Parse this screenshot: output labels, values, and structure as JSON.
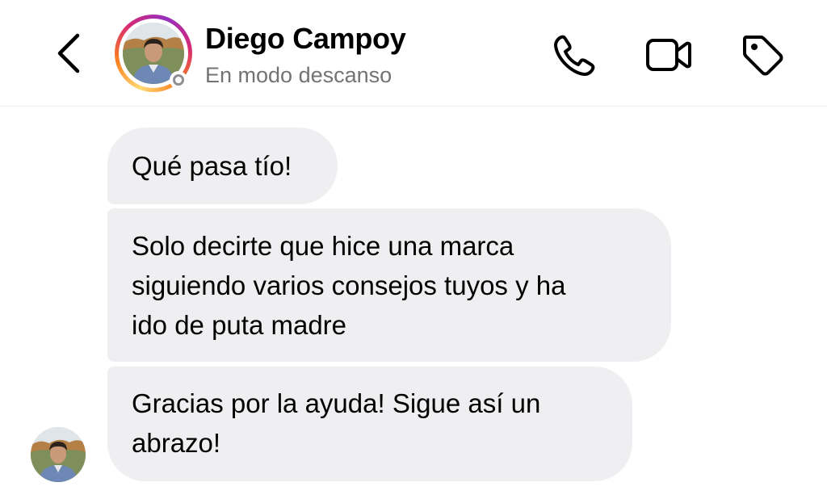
{
  "header": {
    "back_icon": "chevron-left-icon",
    "contact_name": "Diego Campoy",
    "contact_status": "En modo descanso",
    "actions": {
      "phone_icon": "phone-icon",
      "video_icon": "video-camera-icon",
      "tag_icon": "tag-icon"
    }
  },
  "colors": {
    "bubble_background": "#efeff1",
    "status_text": "#737373",
    "story_ring": [
      "#feda75",
      "#fa7e1e",
      "#d62976",
      "#962fbf"
    ]
  },
  "messages": [
    {
      "sender": "Diego Campoy",
      "lines": [
        "Qué pasa tío!"
      ]
    },
    {
      "sender": "Diego Campoy",
      "lines": [
        "Solo decirte que hice una marca",
        "siguiendo varios consejos tuyos y ha",
        "ido de puta madre"
      ]
    },
    {
      "sender": "Diego Campoy",
      "lines": [
        "Gracias por la ayuda! Sigue así un",
        "abrazo!"
      ]
    }
  ]
}
